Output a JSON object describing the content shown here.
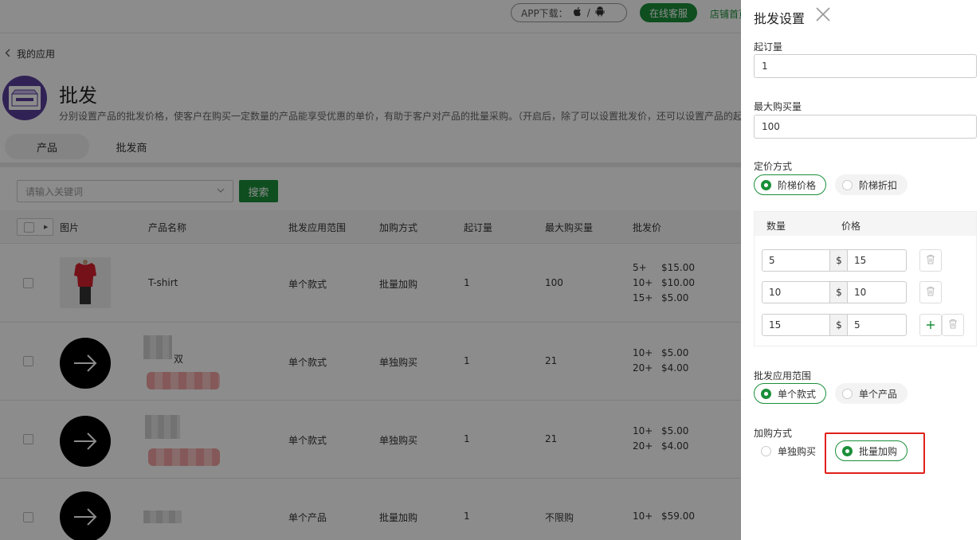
{
  "header": {
    "app_download_label": "APP下载：",
    "apple_icon": "apple-icon",
    "android_icon": "android-icon",
    "separator": "/",
    "service_button": "在线客服",
    "store_link": "店铺首页"
  },
  "page": {
    "back_label": "我的应用",
    "title": "批发",
    "description": "分别设置产品的批发价格，使客户在购买一定数量的产品能享受优惠的单价，有助于客户对产品的批量采购。（开启后，除了可以设置批发价，还可以设置产品的起",
    "tabs": [
      {
        "label": "产品"
      },
      {
        "label": "批发商"
      }
    ],
    "search": {
      "placeholder": "请输入关键词",
      "button": "搜索"
    }
  },
  "table": {
    "headers": {
      "image": "图片",
      "name": "产品名称",
      "scope": "批发应用范围",
      "method": "加购方式",
      "min_qty": "起订量",
      "max_qty": "最大购买量",
      "price": "批发价"
    },
    "rows": [
      {
        "name": "T-shirt",
        "scope": "单个款式",
        "method": "批量加购",
        "min_qty": "1",
        "max_qty": "100",
        "tiers": [
          {
            "q": "5+",
            "p": "$15.00"
          },
          {
            "q": "10+",
            "p": "$10.00"
          },
          {
            "q": "15+",
            "p": "$5.00"
          }
        ]
      },
      {
        "name": "双",
        "scope": "单个款式",
        "method": "单独购买",
        "min_qty": "1",
        "max_qty": "21",
        "tiers": [
          {
            "q": "10+",
            "p": "$5.00"
          },
          {
            "q": "20+",
            "p": "$4.00"
          }
        ]
      },
      {
        "name": "",
        "scope": "单个款式",
        "method": "单独购买",
        "min_qty": "1",
        "max_qty": "21",
        "tiers": [
          {
            "q": "10+",
            "p": "$5.00"
          },
          {
            "q": "20+",
            "p": "$4.00"
          }
        ]
      },
      {
        "name": "",
        "scope": "单个产品",
        "method": "批量加购",
        "min_qty": "1",
        "max_qty": "不限购",
        "tiers": [
          {
            "q": "10+",
            "p": "$59.00"
          }
        ]
      }
    ]
  },
  "panel": {
    "title": "批发设置",
    "min_order_label": "起订量",
    "min_order_value": "1",
    "max_purchase_label": "最大购买量",
    "max_purchase_value": "100",
    "pricing_label": "定价方式",
    "pricing_options": [
      {
        "label": "阶梯价格",
        "selected": true
      },
      {
        "label": "阶梯折扣",
        "selected": false
      }
    ],
    "tier_header": {
      "qty": "数量",
      "price": "价格"
    },
    "currency": "$",
    "tiers": [
      {
        "qty": "5",
        "price": "15"
      },
      {
        "qty": "10",
        "price": "10"
      },
      {
        "qty": "15",
        "price": "5"
      }
    ],
    "scope_label": "批发应用范围",
    "scope_options": [
      {
        "label": "单个款式",
        "selected": true
      },
      {
        "label": "单个产品",
        "selected": false
      }
    ],
    "method_label": "加购方式",
    "method_options": [
      {
        "label": "单独购买",
        "selected": false
      },
      {
        "label": "批量加购",
        "selected": true
      }
    ],
    "accent_color": "#1a8f3a",
    "highlight_color": "#e0201b"
  }
}
